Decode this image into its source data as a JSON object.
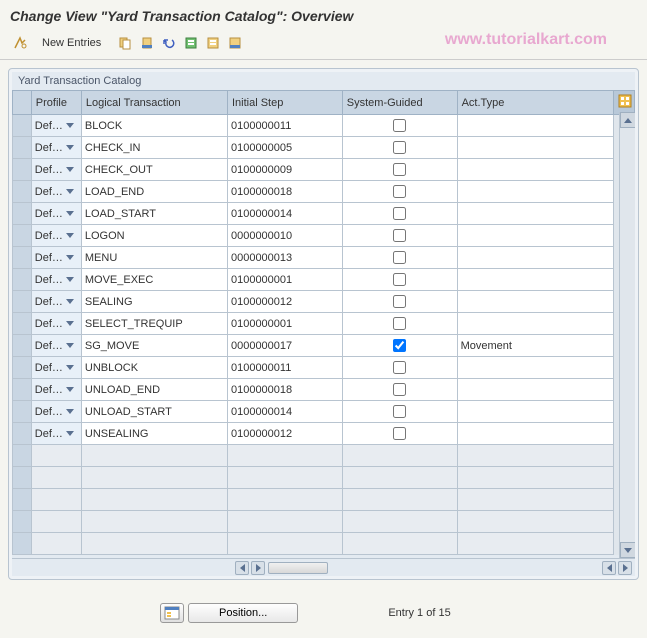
{
  "header": {
    "title": "Change View \"Yard Transaction Catalog\": Overview"
  },
  "toolbar": {
    "new_entries_label": "New Entries",
    "watermark": "www.tutorialkart.com"
  },
  "panel": {
    "title": "Yard Transaction Catalog"
  },
  "table": {
    "columns": {
      "profile": "Profile",
      "logical_transaction": "Logical Transaction",
      "initial_step": "Initial Step",
      "system_guided": "System-Guided",
      "act_type": "Act.Type"
    },
    "rows": [
      {
        "profile": "Def…",
        "logical_transaction": "BLOCK",
        "initial_step": "0100000011",
        "system_guided": false,
        "act_type": ""
      },
      {
        "profile": "Def…",
        "logical_transaction": "CHECK_IN",
        "initial_step": "0100000005",
        "system_guided": false,
        "act_type": ""
      },
      {
        "profile": "Def…",
        "logical_transaction": "CHECK_OUT",
        "initial_step": "0100000009",
        "system_guided": false,
        "act_type": ""
      },
      {
        "profile": "Def…",
        "logical_transaction": "LOAD_END",
        "initial_step": "0100000018",
        "system_guided": false,
        "act_type": ""
      },
      {
        "profile": "Def…",
        "logical_transaction": "LOAD_START",
        "initial_step": "0100000014",
        "system_guided": false,
        "act_type": ""
      },
      {
        "profile": "Def…",
        "logical_transaction": "LOGON",
        "initial_step": "0000000010",
        "system_guided": false,
        "act_type": ""
      },
      {
        "profile": "Def…",
        "logical_transaction": "MENU",
        "initial_step": "0000000013",
        "system_guided": false,
        "act_type": ""
      },
      {
        "profile": "Def…",
        "logical_transaction": "MOVE_EXEC",
        "initial_step": "0100000001",
        "system_guided": false,
        "act_type": ""
      },
      {
        "profile": "Def…",
        "logical_transaction": "SEALING",
        "initial_step": "0100000012",
        "system_guided": false,
        "act_type": ""
      },
      {
        "profile": "Def…",
        "logical_transaction": "SELECT_TREQUIP",
        "initial_step": "0100000001",
        "system_guided": false,
        "act_type": ""
      },
      {
        "profile": "Def…",
        "logical_transaction": "SG_MOVE",
        "initial_step": "0000000017",
        "system_guided": true,
        "act_type": "Movement"
      },
      {
        "profile": "Def…",
        "logical_transaction": "UNBLOCK",
        "initial_step": "0100000011",
        "system_guided": false,
        "act_type": ""
      },
      {
        "profile": "Def…",
        "logical_transaction": "UNLOAD_END",
        "initial_step": "0100000018",
        "system_guided": false,
        "act_type": ""
      },
      {
        "profile": "Def…",
        "logical_transaction": "UNLOAD_START",
        "initial_step": "0100000014",
        "system_guided": false,
        "act_type": ""
      },
      {
        "profile": "Def…",
        "logical_transaction": "UNSEALING",
        "initial_step": "0100000012",
        "system_guided": false,
        "act_type": ""
      }
    ],
    "empty_rows": 5
  },
  "footer": {
    "position_label": "Position...",
    "entry_text": "Entry 1 of 15"
  }
}
